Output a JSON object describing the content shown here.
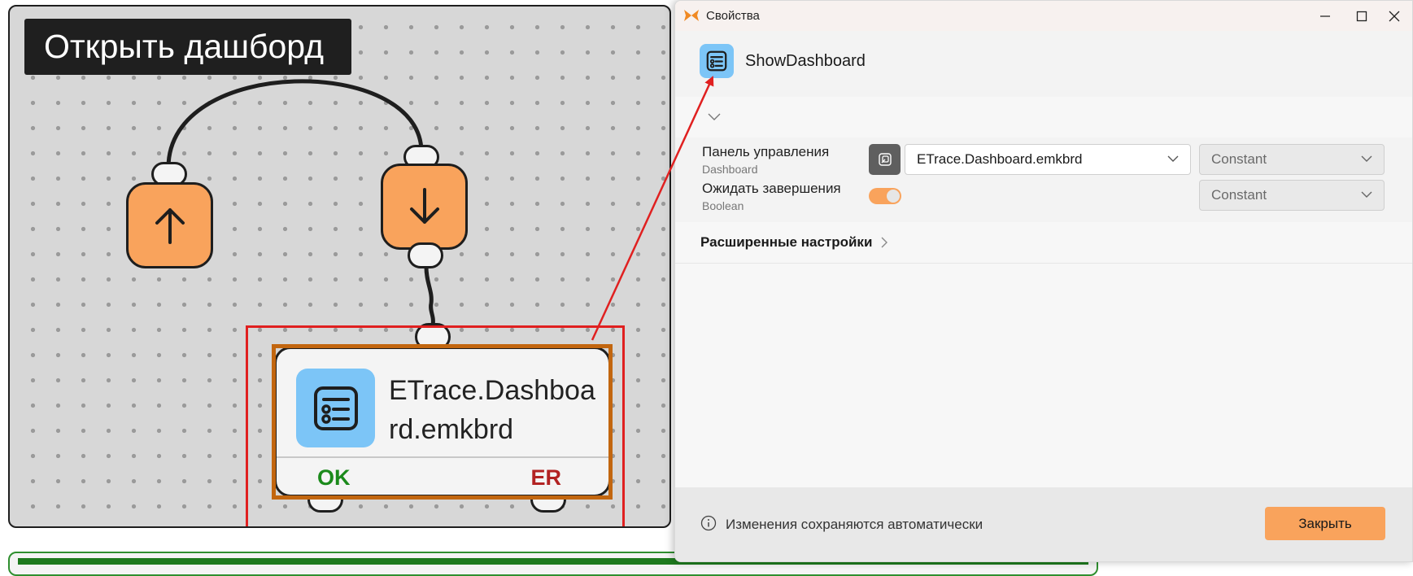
{
  "canvas": {
    "title": "Открыть дашборд",
    "task_node": {
      "name": "ETrace.Dashboard.emkbrd",
      "ok_label": "OK",
      "er_label": "ER"
    },
    "icons": [
      "arrow-up-icon",
      "arrow-down-icon",
      "dashboard-list-icon"
    ]
  },
  "window": {
    "title": "Свойства",
    "controls": [
      "minimize-icon",
      "maximize-icon",
      "close-icon"
    ],
    "node_title": "ShowDashboard",
    "properties": [
      {
        "label": "Панель управления",
        "type": "Dashboard",
        "value": "ETrace.Dashboard.emkbrd",
        "mode": "Constant"
      },
      {
        "label": "Ожидать завершения",
        "type": "Boolean",
        "value": true,
        "mode": "Constant"
      }
    ],
    "advanced_label": "Расширенные настройки",
    "footer_text": "Изменения сохраняются автоматически",
    "close_label": "Закрыть"
  },
  "colors": {
    "accent_orange": "#f9a35c",
    "node_blue": "#7cc5f7",
    "highlight_red": "#e02020",
    "highlight_orange": "#c2660f",
    "ok_green": "#1b8a1b",
    "er_red": "#b22222"
  }
}
